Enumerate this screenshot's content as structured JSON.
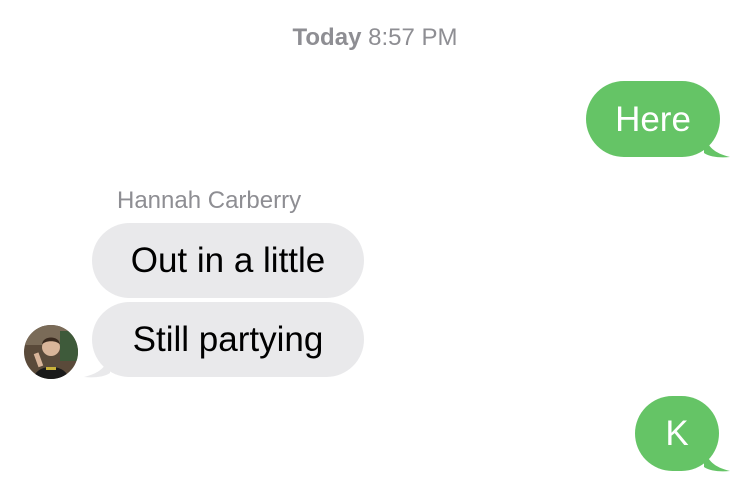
{
  "header": {
    "day": "Today",
    "time": "8:57 PM"
  },
  "messages": [
    {
      "direction": "outgoing",
      "text": "Here"
    },
    {
      "direction": "incoming",
      "sender": "Hannah Carberry",
      "text": "Out in a little"
    },
    {
      "direction": "incoming",
      "text": "Still partying"
    },
    {
      "direction": "outgoing",
      "text": "K"
    }
  ],
  "colors": {
    "outgoing_bubble": "#65c466",
    "incoming_bubble": "#e9e9eb",
    "meta_text": "#8e8e93"
  },
  "contact": {
    "avatar_icon": "contact-photo-icon"
  }
}
